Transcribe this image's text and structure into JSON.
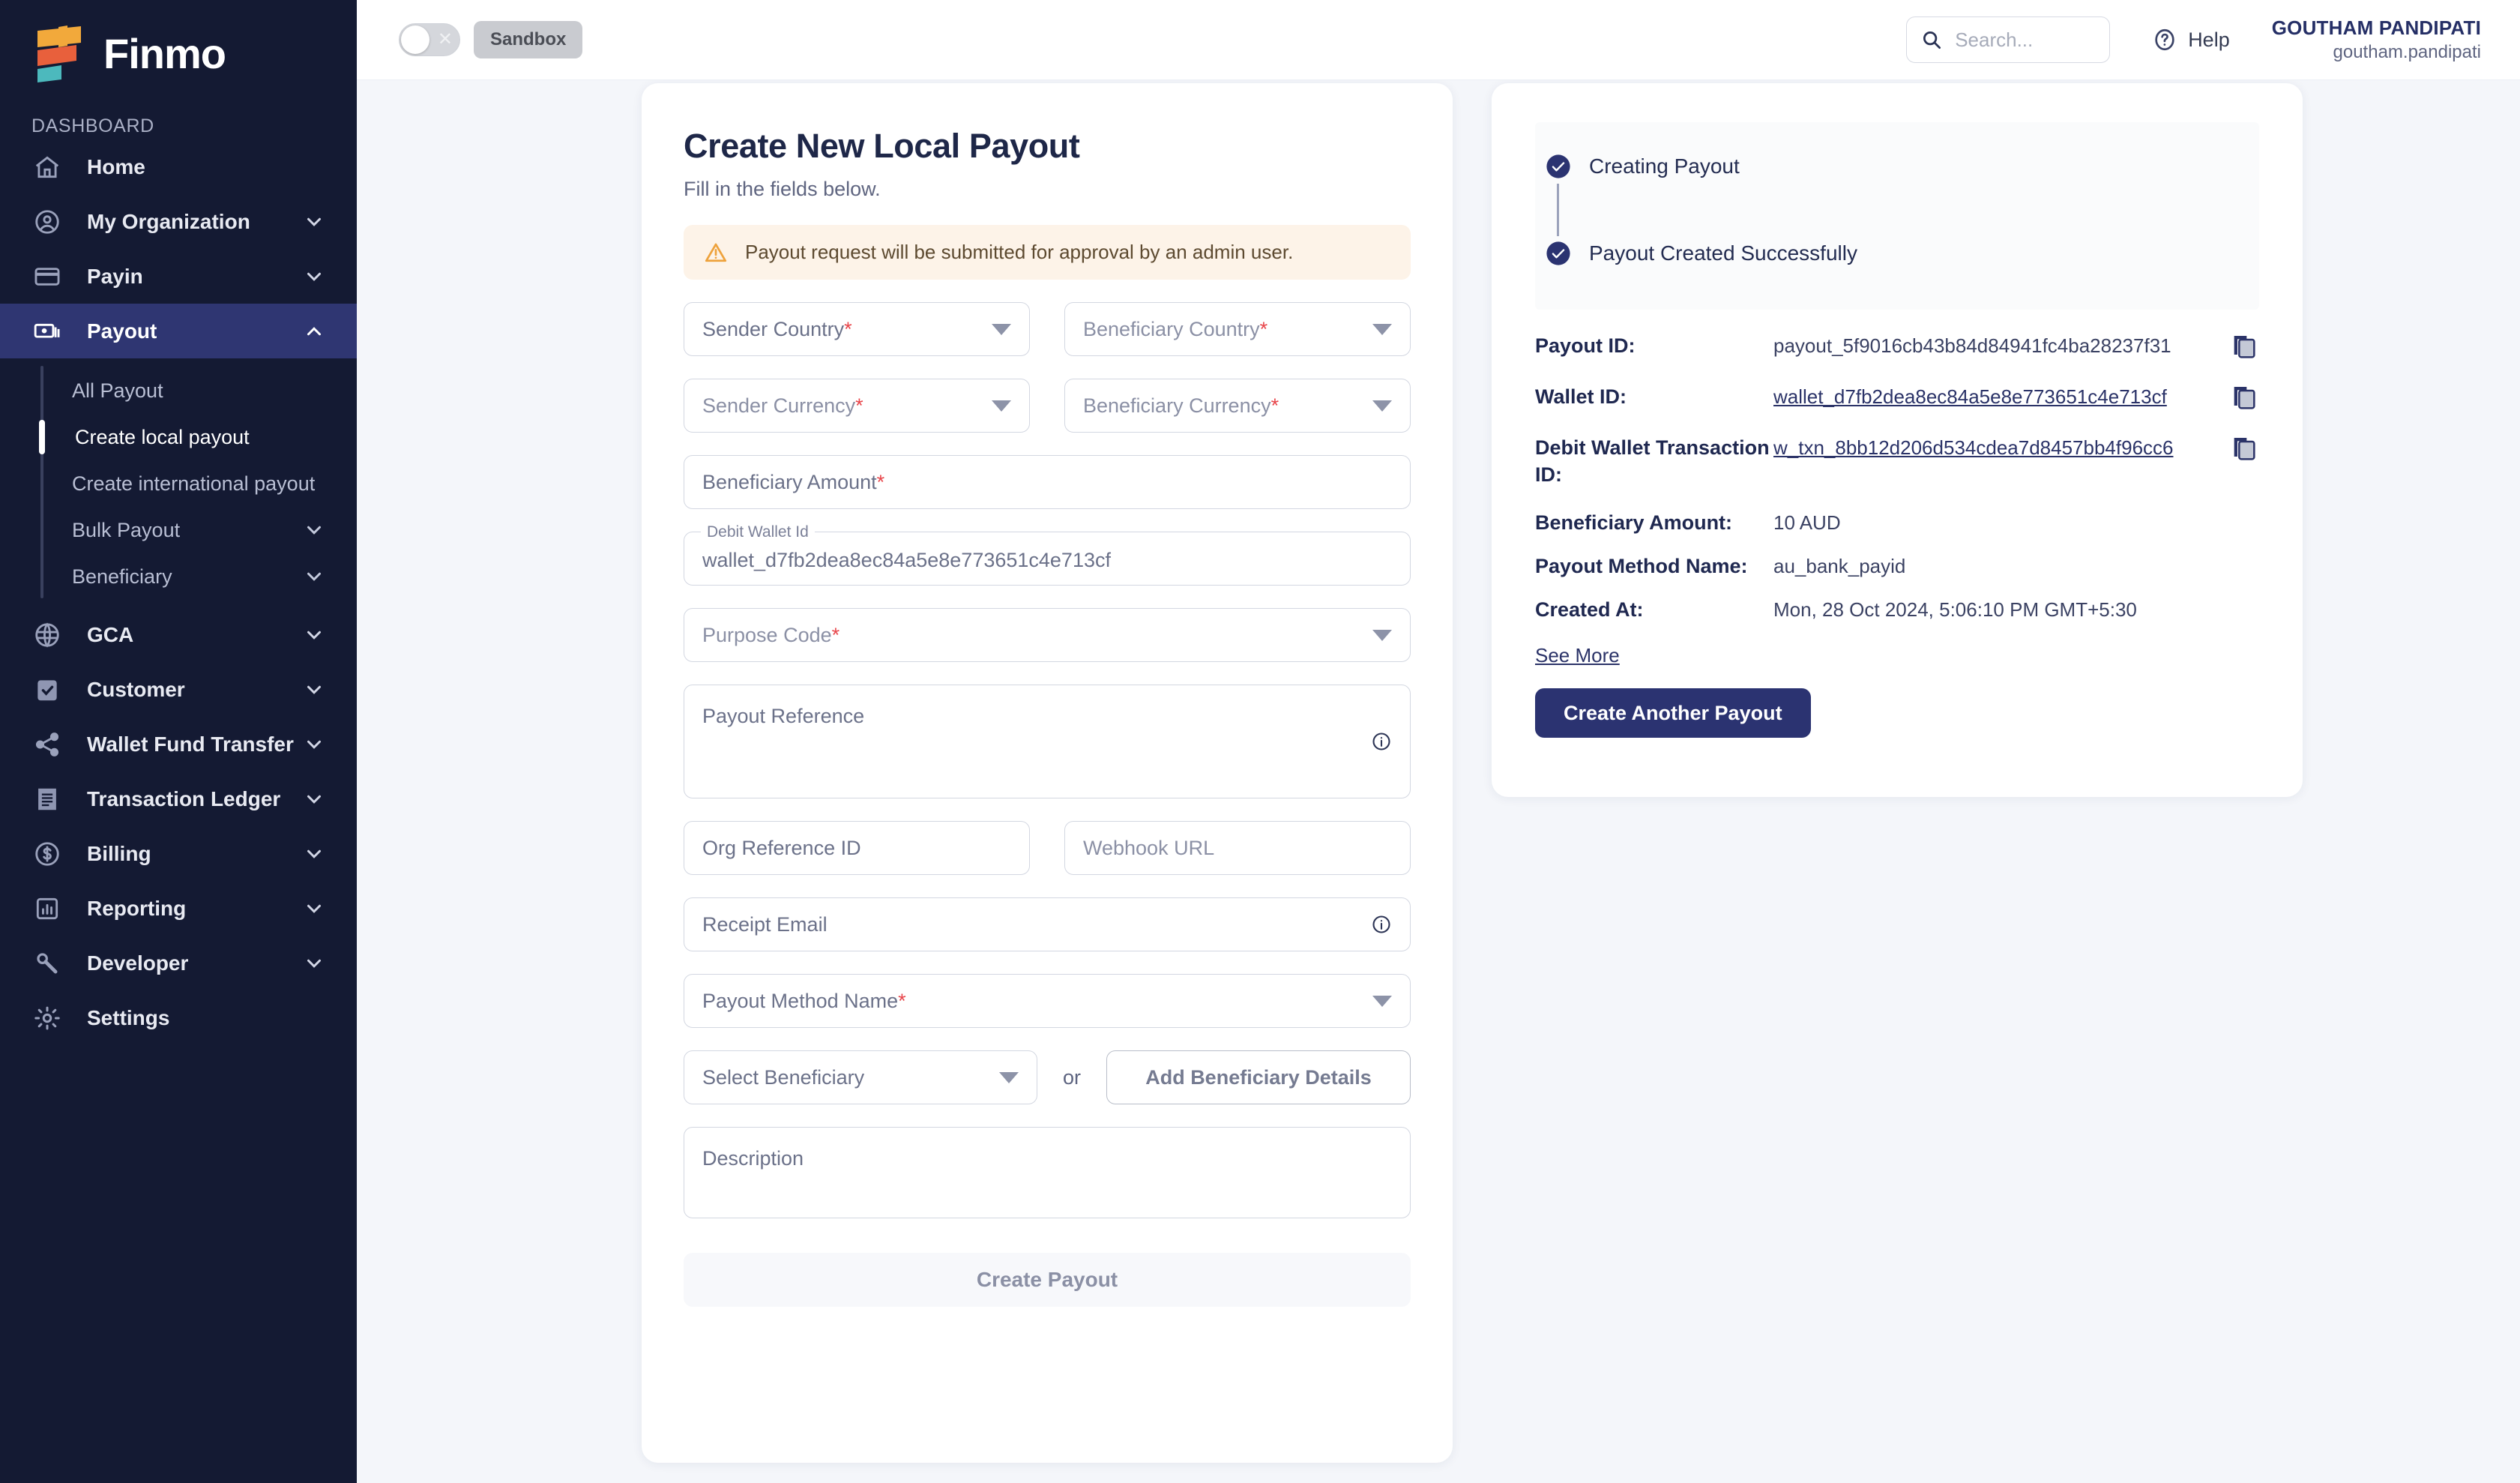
{
  "brand": {
    "name": "Finmo",
    "logo_icon": "finmo-flag-logo"
  },
  "sidebar": {
    "section_label": "DASHBOARD",
    "items": [
      {
        "label": "Home",
        "icon": "home-icon",
        "expandable": false,
        "active": false
      },
      {
        "label": "My Organization",
        "icon": "user-circle-icon",
        "expandable": true,
        "active": false
      },
      {
        "label": "Payin",
        "icon": "credit-card-icon",
        "expandable": true,
        "active": false
      },
      {
        "label": "Payout",
        "icon": "banknote-icon",
        "expandable": true,
        "active": true
      },
      {
        "label": "GCA",
        "icon": "globe-icon",
        "expandable": true,
        "active": false
      },
      {
        "label": "Customer",
        "icon": "clipboard-check-icon",
        "expandable": true,
        "active": false
      },
      {
        "label": "Wallet Fund Transfer",
        "icon": "share-nodes-icon",
        "expandable": true,
        "active": false
      },
      {
        "label": "Transaction Ledger",
        "icon": "receipt-icon",
        "expandable": true,
        "active": false
      },
      {
        "label": "Billing",
        "icon": "dollar-circle-icon",
        "expandable": true,
        "active": false
      },
      {
        "label": "Reporting",
        "icon": "bar-chart-icon",
        "expandable": true,
        "active": false
      },
      {
        "label": "Developer",
        "icon": "wrench-icon",
        "expandable": true,
        "active": false
      },
      {
        "label": "Settings",
        "icon": "gear-icon",
        "expandable": false,
        "active": false
      }
    ],
    "payout_subitems": [
      {
        "label": "All Payout",
        "expandable": false,
        "active": false
      },
      {
        "label": "Create local payout",
        "expandable": false,
        "active": true
      },
      {
        "label": "Create international payout",
        "expandable": false,
        "active": false
      },
      {
        "label": "Bulk Payout",
        "expandable": true,
        "active": false
      },
      {
        "label": "Beneficiary",
        "expandable": true,
        "active": false
      }
    ]
  },
  "topbar": {
    "env_toggle": {
      "state": "off",
      "icon": "toggle-off-x-icon"
    },
    "env_badge": "Sandbox",
    "search": {
      "placeholder": "Search...",
      "value": "",
      "icon": "search-icon"
    },
    "help": {
      "label": "Help",
      "icon": "question-circle-icon"
    },
    "user": {
      "name": "GOUTHAM PANDIPATI",
      "handle": "goutham.pandipati"
    }
  },
  "form": {
    "title": "Create New Local Payout",
    "subtitle": "Fill in the fields below.",
    "warning": {
      "text": "Payout request will be submitted for approval by an admin user.",
      "icon": "warning-triangle-icon"
    },
    "fields": {
      "sender_country": {
        "placeholder": "Sender Country",
        "required": true,
        "value": ""
      },
      "beneficiary_country": {
        "placeholder": "Beneficiary Country",
        "required": true,
        "value": ""
      },
      "sender_currency": {
        "placeholder": "Sender Currency",
        "required": true,
        "value": ""
      },
      "beneficiary_currency": {
        "placeholder": "Beneficiary Currency",
        "required": true,
        "value": ""
      },
      "beneficiary_amount": {
        "placeholder": "Beneficiary Amount",
        "required": true,
        "value": ""
      },
      "debit_wallet_id": {
        "label": "Debit Wallet Id",
        "value": "wallet_d7fb2dea8ec84a5e8e773651c4e713cf"
      },
      "purpose_code": {
        "placeholder": "Purpose Code",
        "required": true,
        "value": ""
      },
      "payout_reference": {
        "placeholder": "Payout Reference",
        "value": "",
        "info_icon": "info-icon"
      },
      "org_reference_id": {
        "placeholder": "Org Reference ID",
        "value": ""
      },
      "webhook_url": {
        "placeholder": "Webhook URL",
        "value": ""
      },
      "receipt_email": {
        "placeholder": "Receipt Email",
        "value": "",
        "info_icon": "info-icon"
      },
      "payout_method_name": {
        "placeholder": "Payout Method Name",
        "required": true,
        "value": ""
      },
      "select_beneficiary": {
        "placeholder": "Select Beneficiary",
        "value": ""
      },
      "or_text": "or",
      "add_beneficiary_button": "Add Beneficiary Details",
      "description": {
        "placeholder": "Description",
        "value": ""
      }
    },
    "submit_button": {
      "label": "Create Payout",
      "disabled": true
    }
  },
  "result": {
    "steps": [
      {
        "label": "Creating Payout",
        "complete": true,
        "icon": "check-circle-icon"
      },
      {
        "label": "Payout Created Successfully",
        "complete": true,
        "icon": "check-circle-icon"
      }
    ],
    "details": [
      {
        "key": "Payout ID:",
        "value": "payout_5f9016cb43b84d84941fc4ba28237f31",
        "link": false,
        "copy": true
      },
      {
        "key": "Wallet ID:",
        "value": "wallet_d7fb2dea8ec84a5e8e773651c4e713cf",
        "link": true,
        "copy": true
      },
      {
        "key": "Debit Wallet Transaction ID:",
        "value": "w_txn_8bb12d206d534cdea7d8457bb4f96cc6",
        "link": true,
        "copy": true
      },
      {
        "key": "Beneficiary Amount:",
        "value": "10 AUD",
        "link": false,
        "copy": false
      },
      {
        "key": "Payout Method Name:",
        "value": "au_bank_payid",
        "link": false,
        "copy": false
      },
      {
        "key": "Created At:",
        "value": "Mon, 28 Oct 2024, 5:06:10 PM GMT+5:30",
        "link": false,
        "copy": false
      }
    ],
    "see_more": "See More",
    "cta_button": "Create Another Payout",
    "copy_icon": "copy-icon"
  },
  "colors": {
    "sidebar_bg": "#141a33",
    "sidebar_active": "#2f3672",
    "brand_navy": "#2b3371",
    "page_bg": "#f4f6fa",
    "warning_bg": "#fdf3e8",
    "warning_accent": "#eea23c",
    "required_red": "#e8454a",
    "logo_yellow": "#f2a93b",
    "logo_orange": "#e8603c",
    "logo_teal": "#4cb9bd"
  }
}
